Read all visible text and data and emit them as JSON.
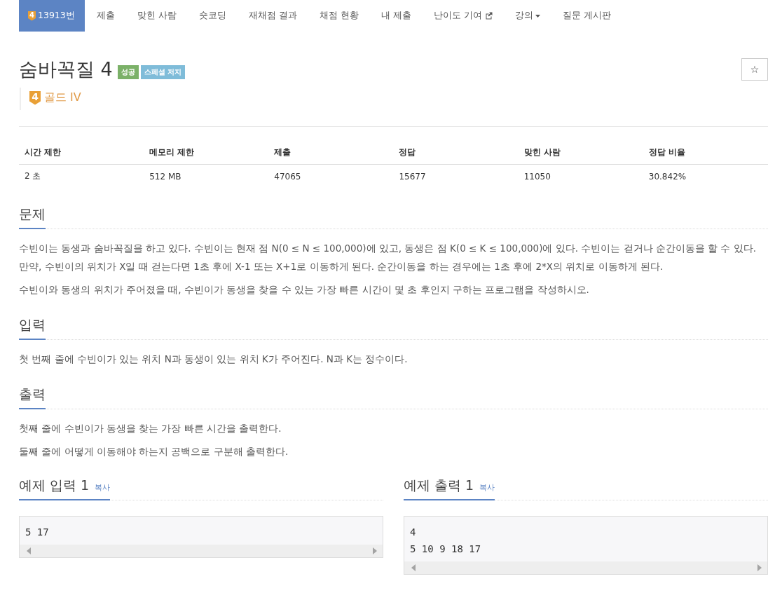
{
  "nav": {
    "tabs": [
      {
        "label": "13913번",
        "kind": "problem",
        "badge": "4",
        "selected": true
      },
      {
        "label": "제출",
        "kind": "link",
        "selected": false
      },
      {
        "label": "맞힌 사람",
        "kind": "link",
        "selected": false
      },
      {
        "label": "숏코딩",
        "kind": "link",
        "selected": false
      },
      {
        "label": "재채점 결과",
        "kind": "link",
        "selected": false
      },
      {
        "label": "채점 현황",
        "kind": "link",
        "selected": false
      },
      {
        "label": "내 제출",
        "kind": "link",
        "selected": false
      },
      {
        "label": "난이도 기여",
        "kind": "external",
        "selected": false
      },
      {
        "label": "강의",
        "kind": "dropdown",
        "selected": false
      },
      {
        "label": "질문 게시판",
        "kind": "link",
        "selected": false
      }
    ]
  },
  "problem": {
    "title": "숨바꼭질 4",
    "labels": [
      {
        "text": "성공",
        "kind": "success"
      },
      {
        "text": "스페셜 저지",
        "kind": "special"
      }
    ],
    "star_button": {
      "symbol": "☆",
      "starred": false
    },
    "tier": {
      "badge": "4",
      "text": "골드 IV"
    }
  },
  "info_table": {
    "columns": [
      "시간 제한",
      "메모리 제한",
      "제출",
      "정답",
      "맞힌 사람",
      "정답 비율"
    ],
    "rows": [
      [
        "2 초",
        "512 MB",
        "47065",
        "15677",
        "11050",
        "30.842%"
      ]
    ]
  },
  "sections": [
    {
      "heading": "문제",
      "paragraphs": [
        "수빈이는 동생과 숨바꼭질을 하고 있다. 수빈이는 현재 점 N(0 ≤ N ≤ 100,000)에 있고, 동생은 점 K(0 ≤ K ≤ 100,000)에 있다. 수빈이는 걷거나 순간이동을 할 수 있다. 만약, 수빈이의 위치가 X일 때 걷는다면 1초 후에 X-1 또는 X+1로 이동하게 된다. 순간이동을 하는 경우에는 1초 후에 2*X의 위치로 이동하게 된다.",
        "수빈이와 동생의 위치가 주어졌을 때, 수빈이가 동생을 찾을 수 있는 가장 빠른 시간이 몇 초 후인지 구하는 프로그램을 작성하시오."
      ]
    },
    {
      "heading": "입력",
      "paragraphs": [
        "첫 번째 줄에 수빈이가 있는 위치 N과 동생이 있는 위치 K가 주어진다. N과 K는 정수이다."
      ]
    },
    {
      "heading": "출력",
      "paragraphs": [
        "첫째 줄에 수빈이가 동생을 찾는 가장 빠른 시간을 출력한다.",
        "둘째 줄에 어떻게 이동해야 하는지 공백으로 구분해 출력한다."
      ]
    }
  ],
  "samples": [
    {
      "heading": "예제 입력 1",
      "copy_label": "복사",
      "lines": [
        "5 17"
      ]
    },
    {
      "heading": "예제 출력 1",
      "copy_label": "복사",
      "lines": [
        "4",
        "5 10 9 18 17"
      ]
    }
  ]
}
